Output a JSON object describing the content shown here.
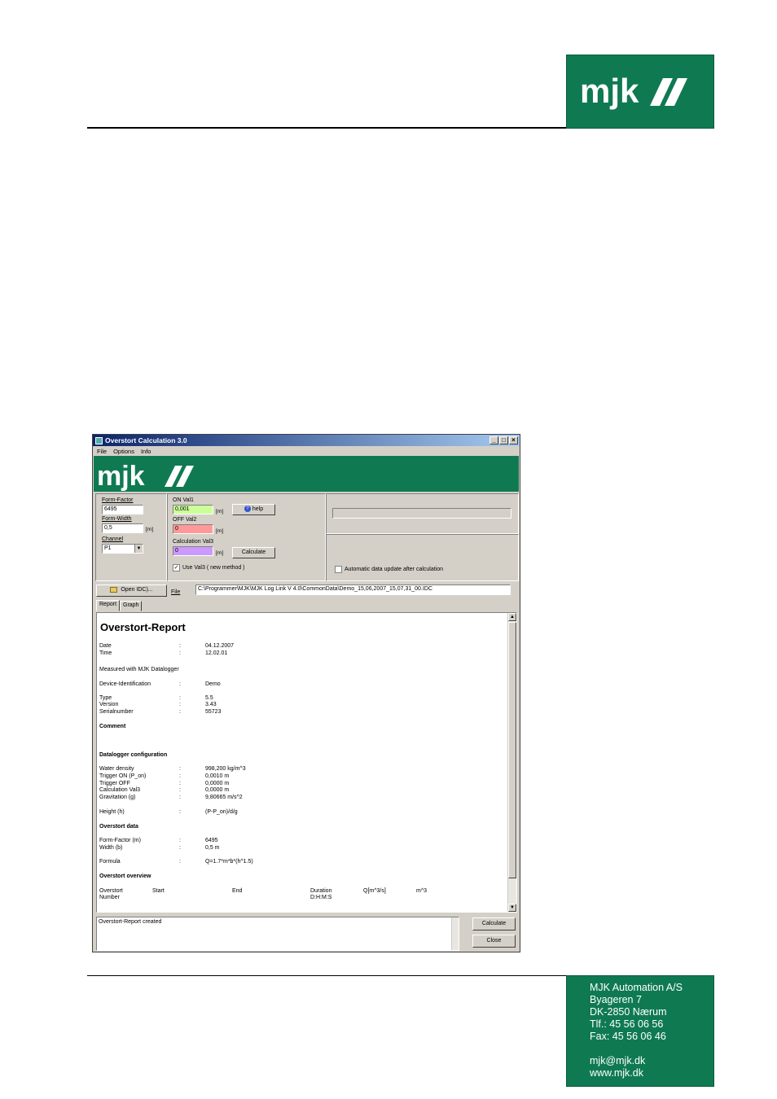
{
  "page": {
    "logo_text": "mjk",
    "company": {
      "name": "MJK Automation A/S",
      "street": "Byageren 7",
      "city": "DK-2850 Nærum",
      "phone": "Tlf.:  45 56 06 56",
      "fax": "Fax:  45 56 06 46",
      "email": "mjk@mjk.dk",
      "web": "www.mjk.dk"
    },
    "brand_color": "#0f7a52"
  },
  "window": {
    "title": "Overstort Calculation 3.0",
    "minimize": "_",
    "maximize": "□",
    "close": "×",
    "menu": [
      "File",
      "Options",
      "Info"
    ],
    "banner_logo": "mjk",
    "form_factor": {
      "label": "Form-Factor",
      "value": "6495"
    },
    "form_width": {
      "label": "Form-Width",
      "value": "0,5",
      "unit": "[m]"
    },
    "channel": {
      "label": "Channel",
      "value": "P1"
    },
    "on_val1": {
      "label": "ON Val1",
      "value": "0,001",
      "unit": "[m]",
      "color": "#ccff99"
    },
    "off_val2": {
      "label": "OFF Val2",
      "value": "0",
      "unit": "[m]",
      "color": "#ff9999"
    },
    "calc_val3": {
      "label": "Calculation Val3",
      "value": "0",
      "unit": "[m]",
      "color": "#cc99ff"
    },
    "help_button": "help",
    "calculate_button": "Calculate",
    "use_val3": {
      "label": "Use Val3 ( new method )",
      "checked": true
    },
    "auto_update": {
      "label": "Automatic data update after calculation",
      "checked": false
    },
    "open_button": "Open IDC)...",
    "file_label": "File",
    "file_path": "C:\\Programmer\\MJK\\MJK Log Link V 4.0\\CommonData\\Demo_15,06,2007_15,07,31_00.IDC",
    "tabs": [
      "Report",
      "Graph"
    ],
    "report": {
      "title": "Overstort-Report",
      "colon": ":",
      "date": {
        "label": "Date",
        "value": "04.12.2007"
      },
      "time": {
        "label": "Time",
        "value": "12.02.01"
      },
      "measured": "Measured with MJK Datalogger",
      "device": {
        "label": "Device-Identification",
        "value": "Demo"
      },
      "type": {
        "label": "Type",
        "value": "5.5"
      },
      "version": {
        "label": "Version",
        "value": "3.43"
      },
      "serial": {
        "label": "Serialnumber",
        "value": "55723"
      },
      "comment_heading": "Comment",
      "config_heading": "Datalogger configuration",
      "water_density": {
        "label": "Water density",
        "value": "998,200 kg/m^3"
      },
      "trigger_on": {
        "label": "Trigger ON (P_on)",
        "value": "0,0010 m"
      },
      "trigger_off": {
        "label": "Trigger OFF",
        "value": "0,0000 m"
      },
      "calc_val3": {
        "label": "Calculation Val3",
        "value": "0,0000 m"
      },
      "gravitation": {
        "label": "Gravitation (g)",
        "value": "9,80665 m/s^2"
      },
      "height": {
        "label": "Height (h)",
        "value": "(P-P_on)/d/g"
      },
      "overstort_heading": "Overstort data",
      "form_factor": {
        "label": "Form-Factor (m)",
        "value": "6495"
      },
      "width": {
        "label": "Width (b)",
        "value": "0,5 m"
      },
      "formula": {
        "label": "Formula",
        "value": "Q=1.7*m*b*(h^1.5)"
      },
      "overview_heading": "Overstort overview",
      "overview_cols": {
        "overstort": "Overstort",
        "number": "Number",
        "start": "Start",
        "end": "End",
        "duration": "Duration",
        "dhms": "D:H:M:S",
        "q": "Q[m^3/s]",
        "m3": "m^3"
      }
    },
    "status_text": "Overstort-Report created",
    "bottom_calculate": "Calculate",
    "bottom_close": "Close"
  }
}
